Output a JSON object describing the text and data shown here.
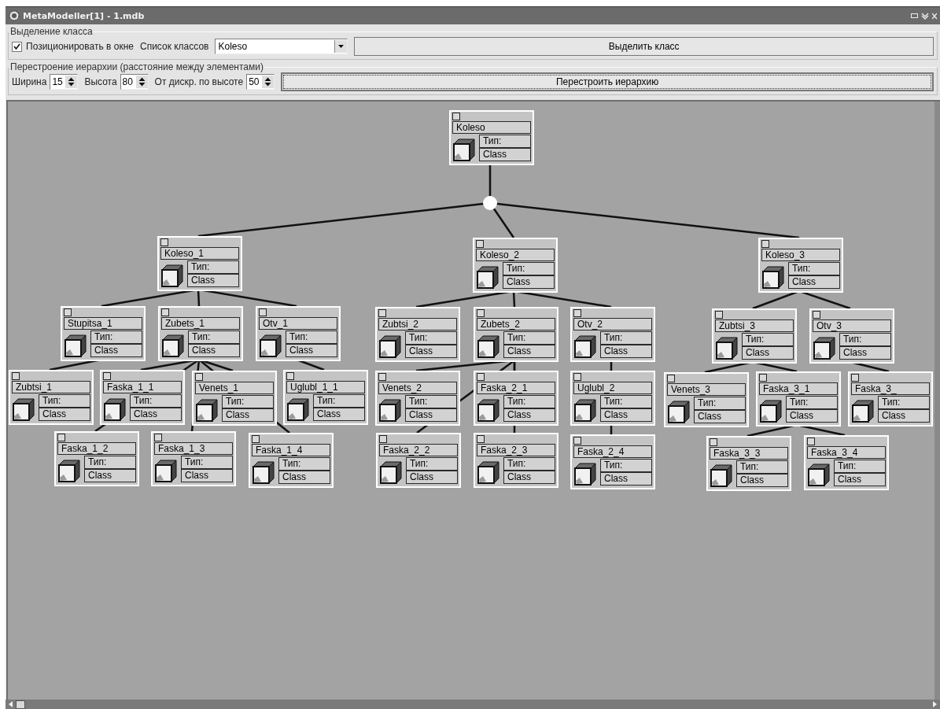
{
  "window": {
    "title": "MetaModeller[1] - 1.mdb"
  },
  "class_selection": {
    "legend": "Выделение класса",
    "position_checkbox": {
      "label": "Позиционировать в окне",
      "checked": true
    },
    "class_list_label": "Список классов",
    "class_list": {
      "value": "Koleso"
    },
    "select_button": "Выделить класс"
  },
  "rebuild": {
    "legend": "Перестроение иерархии (расстояние между элементами)",
    "fields": [
      {
        "label": "Ширина",
        "value": "15"
      },
      {
        "label": "Высота",
        "value": "80"
      },
      {
        "label": "От дискр. по высоте",
        "value": "50"
      }
    ],
    "rebuild_button": "Перестроить иерархию"
  },
  "tree": {
    "name": "Koleso",
    "type_label": "Тип:",
    "type_value": "Class",
    "checked": false,
    "children": [
      {
        "name": "Koleso_1",
        "type_label": "Тип:",
        "type_value": "Class",
        "checked": false,
        "children": [
          {
            "name": "Stupitsa_1",
            "type_label": "Тип:",
            "type_value": "Class",
            "checked": false,
            "children": [
              {
                "name": "Zubtsi_1",
                "type_label": "Тип:",
                "type_value": "Class",
                "checked": false
              }
            ]
          },
          {
            "name": "Zubets_1",
            "type_label": "Тип:",
            "type_value": "Class",
            "checked": false,
            "children": [
              {
                "name": "Faska_1_1",
                "type_label": "Тип:",
                "type_value": "Class",
                "checked": false
              },
              {
                "name": "Venets_1",
                "type_label": "Тип:",
                "type_value": "Class",
                "checked": false
              },
              {
                "name": "Faska_1_2",
                "type_label": "Тип:",
                "type_value": "Class",
                "checked": false
              },
              {
                "name": "Faska_1_3",
                "type_label": "Тип:",
                "type_value": "Class",
                "checked": false
              },
              {
                "name": "Faska_1_4",
                "type_label": "Тип:",
                "type_value": "Class",
                "checked": false
              }
            ]
          },
          {
            "name": "Otv_1",
            "type_label": "Тип:",
            "type_value": "Class",
            "checked": false,
            "children": [
              {
                "name": "Uglubl_1_1",
                "type_label": "Тип:",
                "type_value": "Class",
                "checked": false
              }
            ]
          }
        ]
      },
      {
        "name": "Koleso_2",
        "type_label": "Тип:",
        "type_value": "Class",
        "checked": false,
        "children": [
          {
            "name": "Zubtsi_2",
            "type_label": "Тип:",
            "type_value": "Class",
            "checked": false
          },
          {
            "name": "Zubets_2",
            "type_label": "Тип:",
            "type_value": "Class",
            "checked": false,
            "children": [
              {
                "name": "Venets_2",
                "type_label": "Тип:",
                "type_value": "Class",
                "checked": false
              },
              {
                "name": "Faska_2_1",
                "type_label": "Тип:",
                "type_value": "Class",
                "checked": false
              },
              {
                "name": "Faska_2_2",
                "type_label": "Тип:",
                "type_value": "Class",
                "checked": false
              },
              {
                "name": "Faska_2_3",
                "type_label": "Тип:",
                "type_value": "Class",
                "checked": false
              }
            ]
          },
          {
            "name": "Otv_2",
            "type_label": "Тип:",
            "type_value": "Class",
            "checked": false,
            "children": [
              {
                "name": "Uglubl_2",
                "type_label": "Тип:",
                "type_value": "Class",
                "checked": false,
                "children": [
                  {
                    "name": "Faska_2_4",
                    "type_label": "Тип:",
                    "type_value": "Class",
                    "checked": false
                  }
                ]
              }
            ]
          }
        ]
      },
      {
        "name": "Koleso_3",
        "type_label": "Тип:",
        "type_value": "Class",
        "checked": false,
        "children": [
          {
            "name": "Zubtsi_3",
            "type_label": "Тип:",
            "type_value": "Class",
            "checked": false,
            "children": [
              {
                "name": "Venets_3",
                "type_label": "Тип:",
                "type_value": "Class",
                "checked": false
              },
              {
                "name": "Faska_3_1",
                "type_label": "Тип:",
                "type_value": "Class",
                "checked": false,
                "children": [
                  {
                    "name": "Faska_3_3",
                    "type_label": "Тип:",
                    "type_value": "Class",
                    "checked": false
                  },
                  {
                    "name": "Faska_3_4",
                    "type_label": "Тип:",
                    "type_value": "Class",
                    "checked": false
                  }
                ]
              }
            ]
          },
          {
            "name": "Otv_3",
            "type_label": "Тип:",
            "type_value": "Class",
            "checked": false,
            "children": [
              {
                "name": "Faska_3_",
                "type_label": "Тип:",
                "type_value": "Class",
                "checked": false
              }
            ]
          }
        ]
      }
    ]
  }
}
